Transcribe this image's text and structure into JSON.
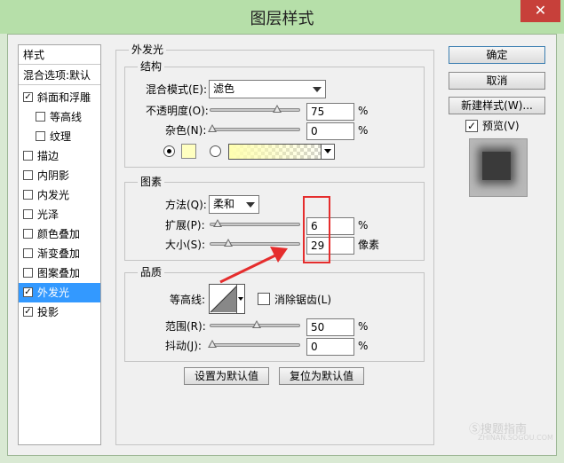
{
  "window": {
    "title": "图层样式",
    "close_glyph": "✕"
  },
  "styles_panel": {
    "header": "样式",
    "blend_options": "混合选项:默认",
    "items": [
      {
        "label": "斜面和浮雕",
        "checked": true
      },
      {
        "label": "等高线",
        "checked": false
      },
      {
        "label": "纹理",
        "checked": false
      },
      {
        "label": "描边",
        "checked": false
      },
      {
        "label": "内阴影",
        "checked": false
      },
      {
        "label": "内发光",
        "checked": false
      },
      {
        "label": "光泽",
        "checked": false
      },
      {
        "label": "颜色叠加",
        "checked": false
      },
      {
        "label": "渐变叠加",
        "checked": false
      },
      {
        "label": "图案叠加",
        "checked": false
      },
      {
        "label": "外发光",
        "checked": true,
        "selected": true
      },
      {
        "label": "投影",
        "checked": true
      }
    ]
  },
  "outer_glow": {
    "title": "外发光",
    "structure": {
      "title": "结构",
      "blend_mode_label": "混合模式(E):",
      "blend_mode_value": "滤色",
      "opacity_label": "不透明度(O):",
      "opacity_value": "75",
      "opacity_unit": "%",
      "noise_label": "杂色(N):",
      "noise_value": "0",
      "noise_unit": "%"
    },
    "elements": {
      "title": "图素",
      "technique_label": "方法(Q):",
      "technique_value": "柔和",
      "spread_label": "扩展(P):",
      "spread_value": "6",
      "spread_unit": "%",
      "size_label": "大小(S):",
      "size_value": "29",
      "size_unit": "像素"
    },
    "quality": {
      "title": "品质",
      "contour_label": "等高线:",
      "anti_alias_label": "消除锯齿(L)",
      "range_label": "范围(R):",
      "range_value": "50",
      "range_unit": "%",
      "jitter_label": "抖动(J):",
      "jitter_value": "0",
      "jitter_unit": "%"
    },
    "set_default_button": "设置为默认值",
    "reset_default_button": "复位为默认值"
  },
  "right_buttons": {
    "ok": "确定",
    "cancel": "取消",
    "new_style": "新建样式(W)...",
    "preview_label": "预览(V)"
  },
  "watermark": {
    "text": "Ⓢ搜题指南",
    "sub": "ZHINAN.SOGOU.COM"
  },
  "colors": {
    "glow_color": "#ffffc0",
    "selection": "#3399ff",
    "annotation_red": "#e52d2d",
    "title_bar": "#b6dfa9"
  }
}
